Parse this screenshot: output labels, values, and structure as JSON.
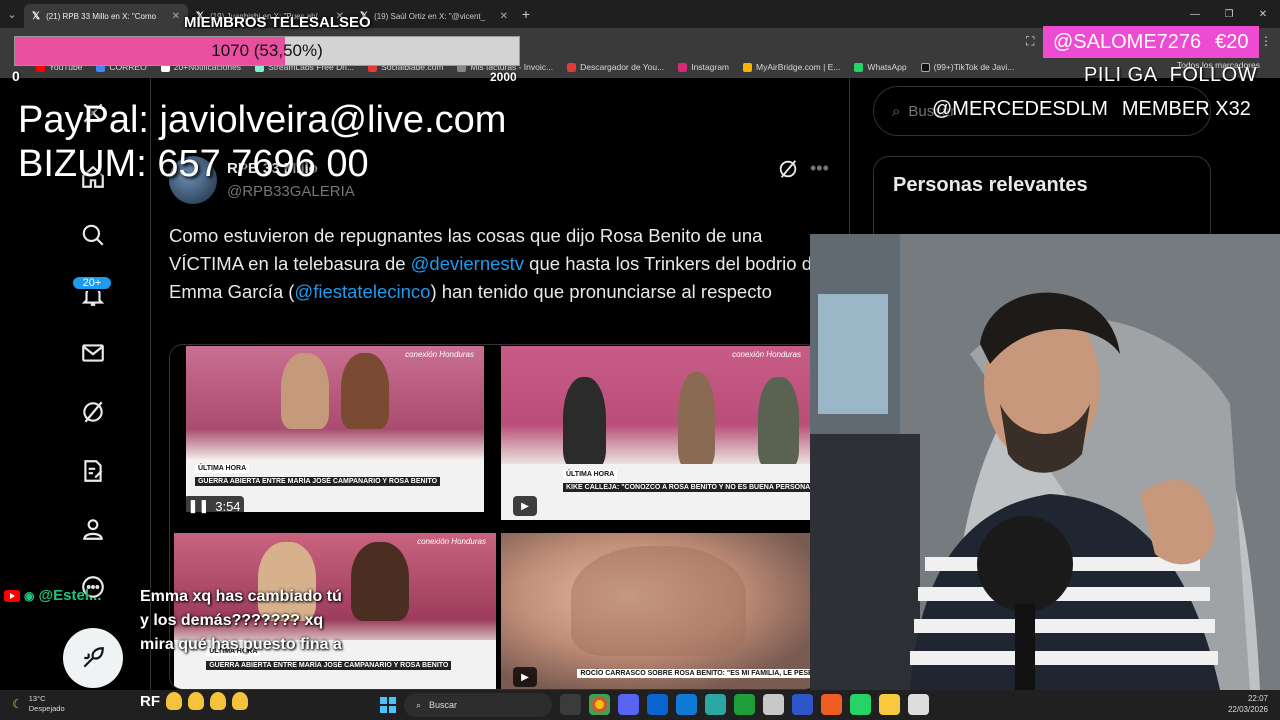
{
  "browser": {
    "tabs": [
      {
        "title": "(21) RPB 33 Millo en X: \"Como",
        "active": true
      },
      {
        "title": "(19) Juanbisbi en X: \"Pues ahí",
        "active": false
      },
      {
        "title": "(19) Saúl Ortiz en X: \"@vicent_",
        "active": false
      }
    ],
    "new_tab": "+",
    "bookmarks": [
      "YouTube",
      "CORREO",
      "20+Notificaciones",
      "StreamLabs Free Dri...",
      "Socialblade.com",
      "Mis facturas - Invoic...",
      "Descargador de You...",
      "Instagram",
      "MyAirBridge.com | E...",
      "WhatsApp",
      "(99+)TikTok de Javi..."
    ],
    "all_bookmarks": "Todos los marcadores"
  },
  "overlay": {
    "members_title": "MIEMBROS TELESALSEO",
    "goal_text": "1070 (53,50%)",
    "goal_fraction": 0.535,
    "goal_min": "0",
    "goal_max": "2000",
    "donation_user": "@SALOME7276",
    "donation_amount": "€20",
    "follow_name": "PILI GA",
    "follow_label": "FOLLOW",
    "member_user": "@MERCEDESDLM",
    "member_label": "MEMBER X32",
    "paypal_line": "PayPal: javiolveira@live.com",
    "bizum_line": "BIZUM: 657 7696 00"
  },
  "nav": {
    "notif_badge": "20+"
  },
  "tweet": {
    "username": "RPB 33 Millo",
    "handle": "@RPB33GALERIA",
    "text_before": "Como estuvieron de repugnantes las cosas que dijo Rosa Benito de una VÍCTIMA en la telebasura de ",
    "mention1": "@deviernestv",
    "text_middle": " que hasta los Trinkers del bodrio de Emma García (",
    "mention2": "@fiestatelecinco",
    "text_after": ") han tenido que pronunciarse al respecto",
    "video_duration": "3:54",
    "thumbs": [
      {
        "brand": "conexión Honduras",
        "headline": "GUERRA ABIERTA ENTRE MARÍA JOSÉ CAMPANARIO Y ROSA BENITO",
        "tag": "ÚLTIMA HORA"
      },
      {
        "brand": "conexión Honduras",
        "headline": "KIKE CALLEJA: \"CONOZCO A ROSA BENITO Y NO ES BUENA PERSONA\"",
        "tag": "ÚLTIMA HORA"
      },
      {
        "brand": "conexión Honduras",
        "headline": "GUERRA ABIERTA ENTRE MARÍA JOSÉ CAMPANARIO Y ROSA BENITO",
        "tag": "ÚLTIMA HORA"
      },
      {
        "brand": "",
        "headline": "ROCÍO CARRASCO SOBRE ROSA BENITO: \"ES MI FAMILIA, LE PESE A QUIEN LE PESE\"",
        "tag": ""
      }
    ]
  },
  "sidebar": {
    "search_placeholder": "Buscar",
    "relevant_title": "Personas relevantes"
  },
  "chat": {
    "user": "@Estel...",
    "message": "Emma xq has cambiado tú y los demás??????? xq mira qué has puesto fina a",
    "next_user": "RF"
  },
  "taskbar": {
    "temperature": "13°C",
    "weather": "Despejado",
    "search": "Buscar",
    "time": "22:07",
    "date": "22/03/2026"
  }
}
